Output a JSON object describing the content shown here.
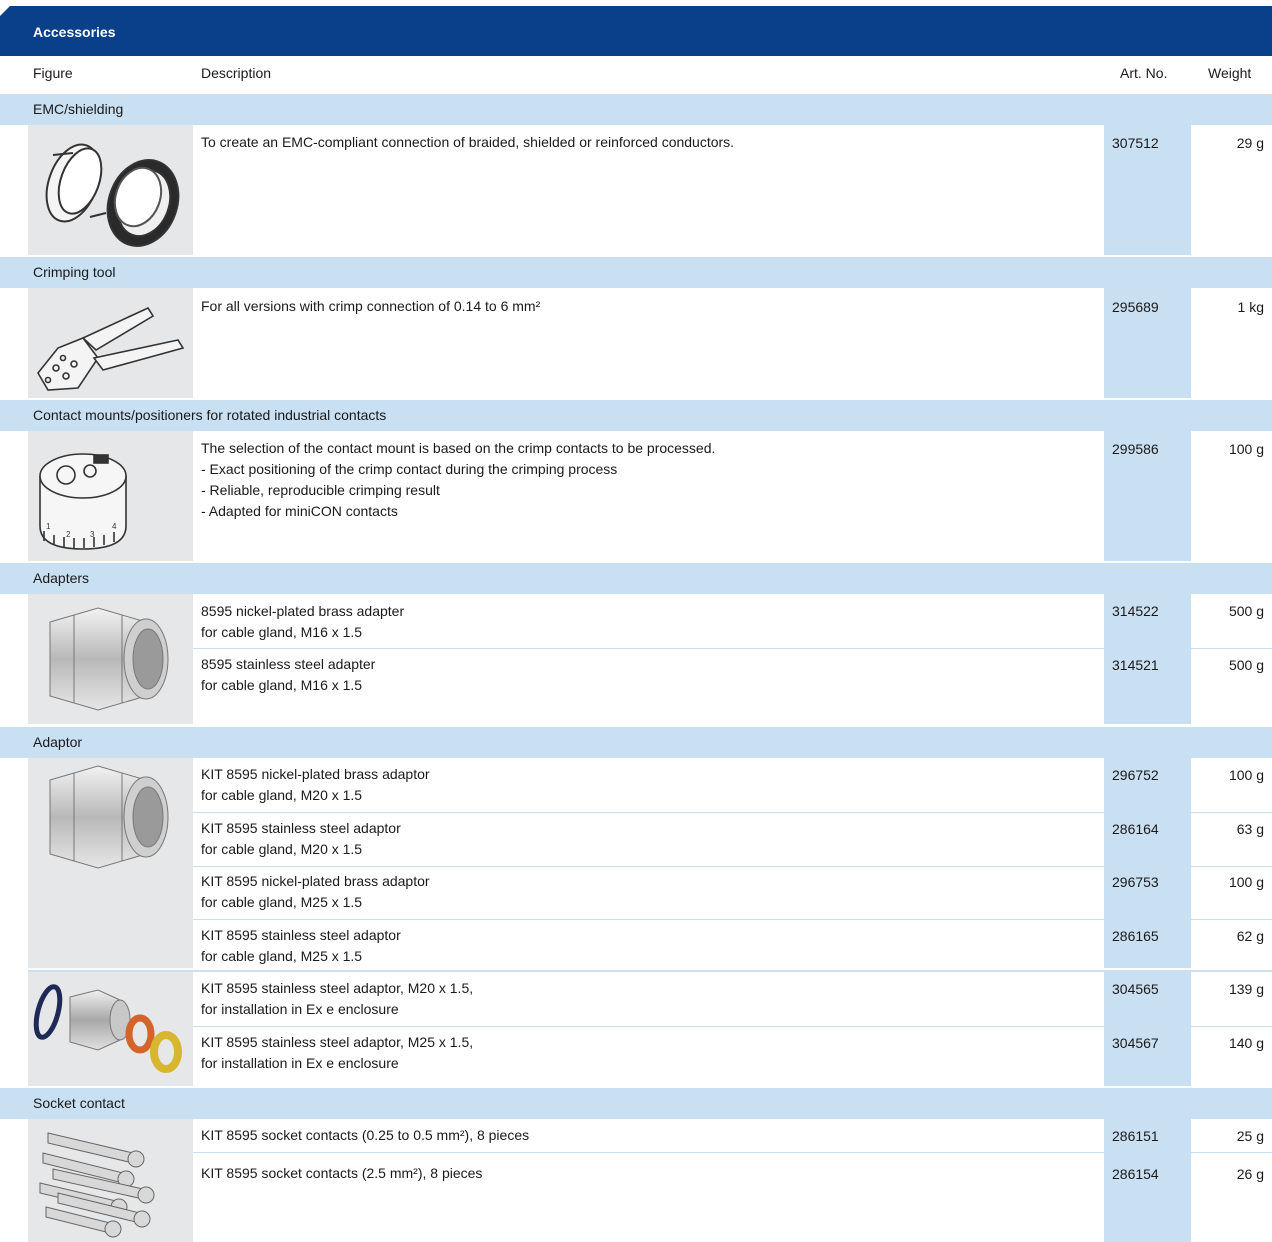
{
  "header": {
    "title": "Accessories"
  },
  "columns": {
    "figure": "Figure",
    "description": "Description",
    "art_no": "Art. No.",
    "weight": "Weight"
  },
  "sections": [
    {
      "title": "EMC/shielding",
      "items": [
        {
          "description": "To create an EMC-compliant connection of braided, shielded or reinforced conductors.",
          "art_no": "307512",
          "weight": "29 g"
        }
      ]
    },
    {
      "title": "Crimping tool",
      "items": [
        {
          "description": "For all versions with crimp connection of 0.14 to 6 mm²",
          "art_no": "295689",
          "weight": "1 kg"
        }
      ]
    },
    {
      "title": "Contact mounts/positioners for rotated industrial contacts",
      "items": [
        {
          "description": "The selection of the contact mount is based on the crimp contacts to be processed.\n- Exact positioning of the crimp contact during the crimping process\n- Reliable, reproducible crimping result\n- Adapted for miniCON contacts",
          "art_no": "299586",
          "weight": "100 g"
        }
      ]
    },
    {
      "title": "Adapters",
      "items": [
        {
          "description": "8595 nickel-plated brass adapter\nfor cable gland, M16 x 1.5",
          "art_no": "314522",
          "weight": "500 g"
        },
        {
          "description": "8595 stainless steel adapter\nfor cable gland, M16 x 1.5",
          "art_no": "314521",
          "weight": "500 g"
        }
      ]
    },
    {
      "title": "Adaptor",
      "items": [
        {
          "description": "KIT 8595 nickel-plated brass adaptor\nfor cable gland, M20 x 1.5",
          "art_no": "296752",
          "weight": "100 g"
        },
        {
          "description": "KIT 8595 stainless steel adaptor\nfor cable gland, M20 x 1.5",
          "art_no": "286164",
          "weight": "63 g"
        },
        {
          "description": "KIT 8595 nickel-plated brass adaptor\nfor cable gland, M25 x 1.5",
          "art_no": "296753",
          "weight": "100 g"
        },
        {
          "description": "KIT 8595 stainless steel adaptor\nfor cable gland, M25 x 1.5",
          "art_no": "286165",
          "weight": "62 g"
        },
        {
          "description": "KIT 8595 stainless steel adaptor, M20 x 1.5,\nfor installation in Ex e enclosure",
          "art_no": "304565",
          "weight": "139 g"
        },
        {
          "description": "KIT 8595 stainless steel adaptor, M25 x 1.5,\nfor installation in Ex e enclosure",
          "art_no": "304567",
          "weight": "140 g"
        }
      ]
    },
    {
      "title": "Socket contact",
      "items": [
        {
          "description": "KIT 8595 socket contacts (0.25 to 0.5 mm²), 8 pieces",
          "art_no": "286151",
          "weight": "25 g"
        },
        {
          "description": "KIT 8595 socket contacts (2.5 mm²), 8 pieces",
          "art_no": "286154",
          "weight": "26 g"
        }
      ]
    }
  ],
  "figure_labels": {
    "positioner_numbers": [
      "1",
      "2",
      "3",
      "4"
    ]
  },
  "colors": {
    "header": "#0a3f8a",
    "category": "#c9dff2",
    "figure_bg": "#e6e7e8"
  }
}
